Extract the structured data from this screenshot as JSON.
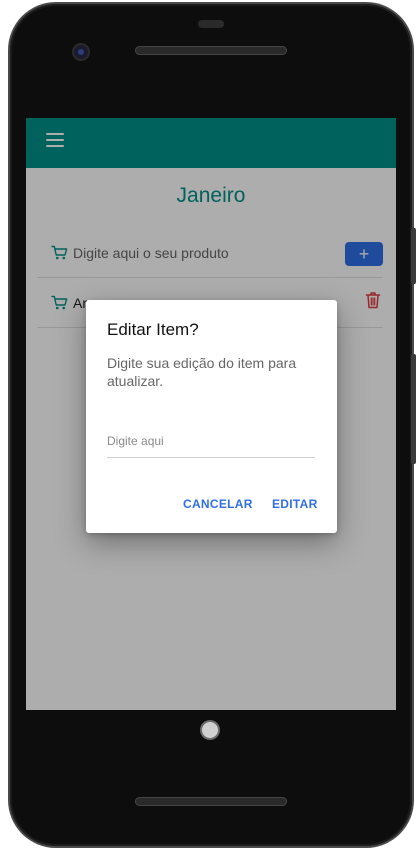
{
  "app": {
    "month_title": "Janeiro",
    "colors": {
      "primary": "#00918a",
      "accent": "#2f6fe6",
      "danger": "#e0383e"
    }
  },
  "list": {
    "input_placeholder": "Digite aqui o seu produto",
    "add_label": "+",
    "items": [
      {
        "name": "Ar"
      }
    ]
  },
  "dialog": {
    "title": "Editar Item?",
    "message": "Digite sua edição do item para atualizar.",
    "input_placeholder": "Digite aqui",
    "cancel_label": "CANCELAR",
    "confirm_label": "EDITAR"
  },
  "icons": [
    "menu-icon",
    "cart-icon",
    "plus-icon",
    "trash-icon",
    "camera-icon"
  ]
}
